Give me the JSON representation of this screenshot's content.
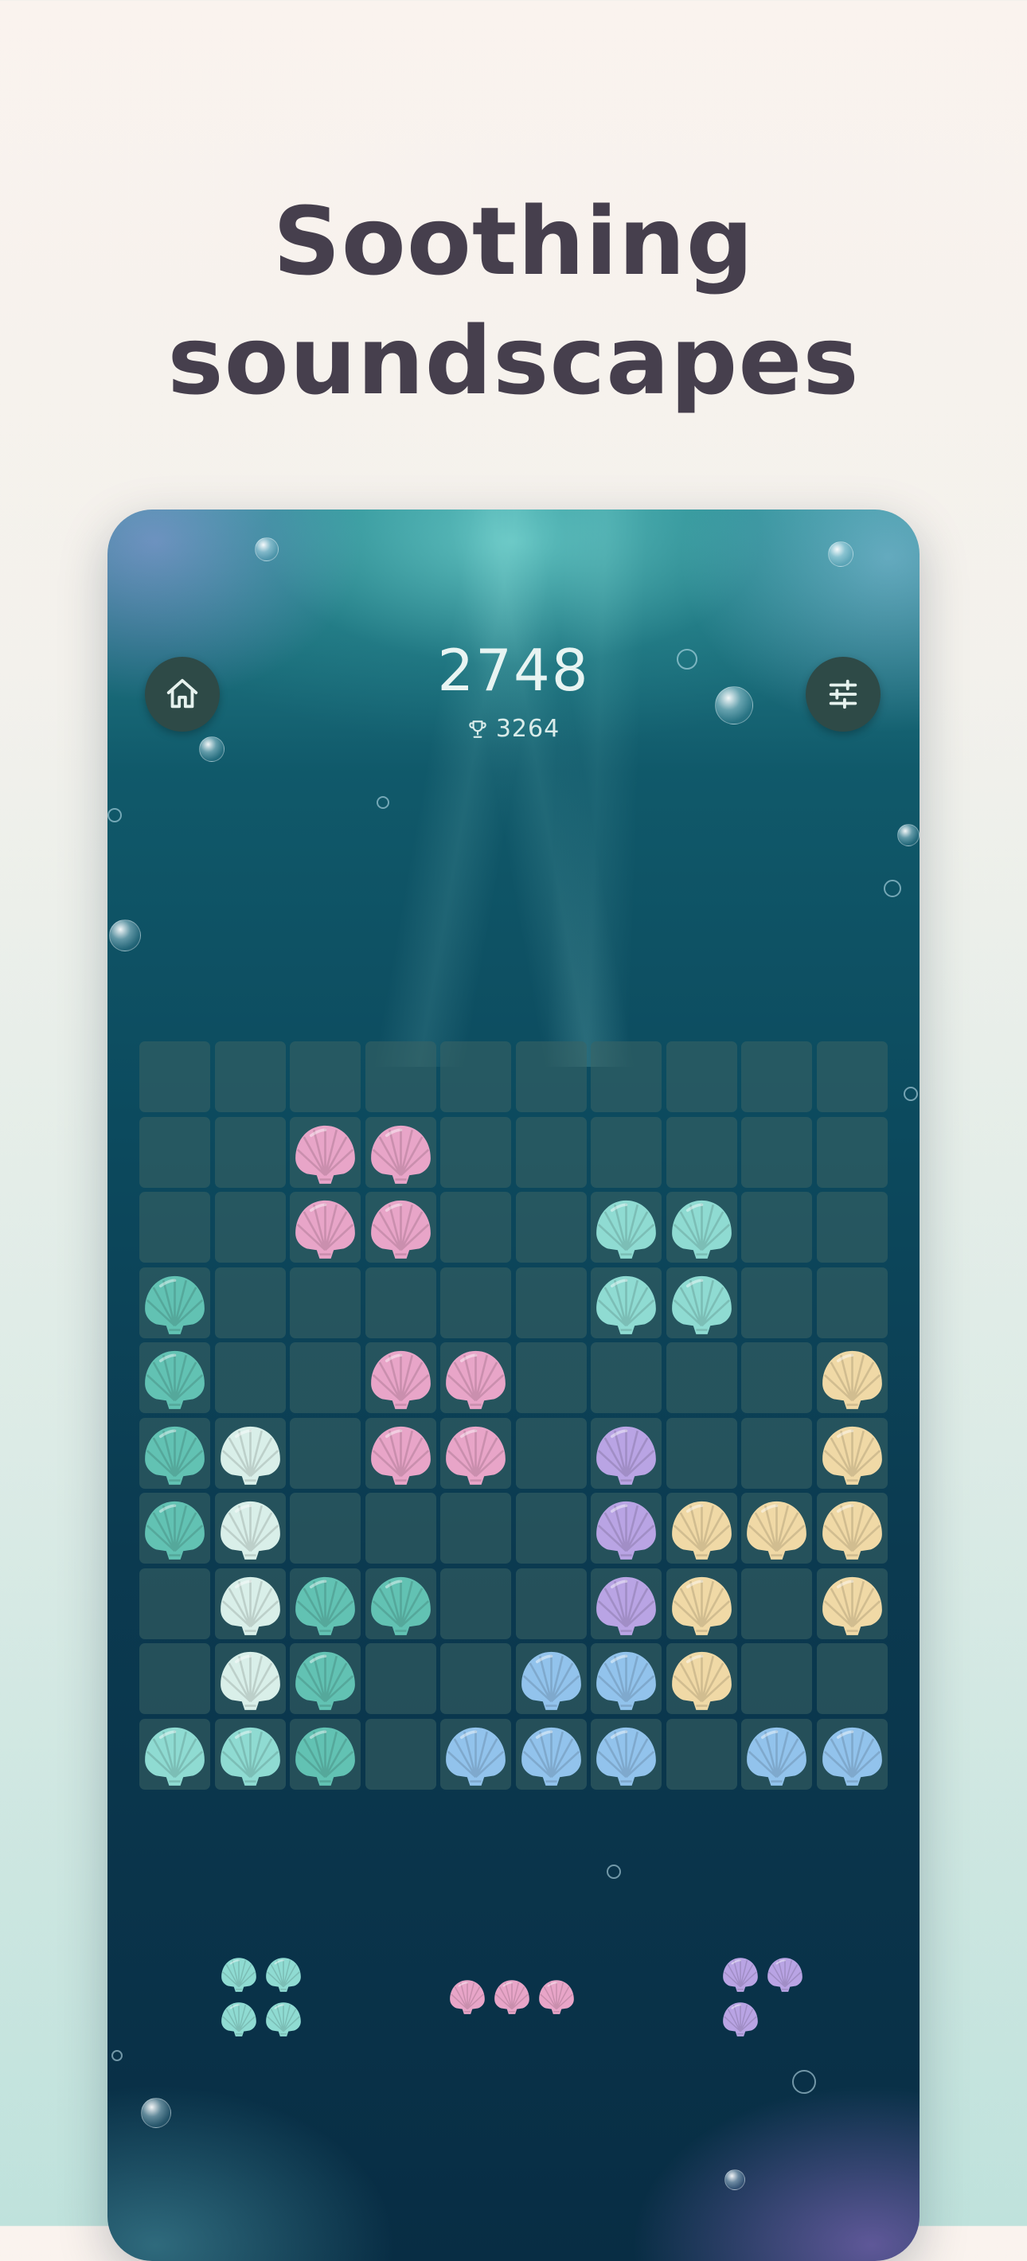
{
  "headline": {
    "line1": "Soothing",
    "line2": "soundscapes"
  },
  "game": {
    "score": "2748",
    "best_score": "3264",
    "icons": {
      "home": "home-icon",
      "settings": "sliders-icon",
      "best": "trophy-icon"
    },
    "colors": {
      "P": "#e8a5c8",
      "T": "#8fdbd2",
      "G": "#62c2b3",
      "W": "#d9efe9",
      "L": "#b9a4e4",
      "Y": "#f0d9a6",
      "B": "#92c3ec"
    },
    "board": {
      "rows": 10,
      "cols": 10,
      "grid": [
        "..........",
        "..PP......",
        "..PP..TT..",
        "G.....TT..",
        "G..PP....Y",
        "GW.PP.L..Y",
        "GW....LYYY",
        ".WGG..LY.Y",
        ".WG..BBY..",
        "TTG.BBB.BB"
      ]
    },
    "tray": [
      {
        "color": "T",
        "shape": [
          "XX",
          "XX"
        ]
      },
      {
        "color": "P",
        "shape": [
          "XXX"
        ]
      },
      {
        "color": "L",
        "shape": [
          "XX",
          "X."
        ]
      }
    ]
  }
}
